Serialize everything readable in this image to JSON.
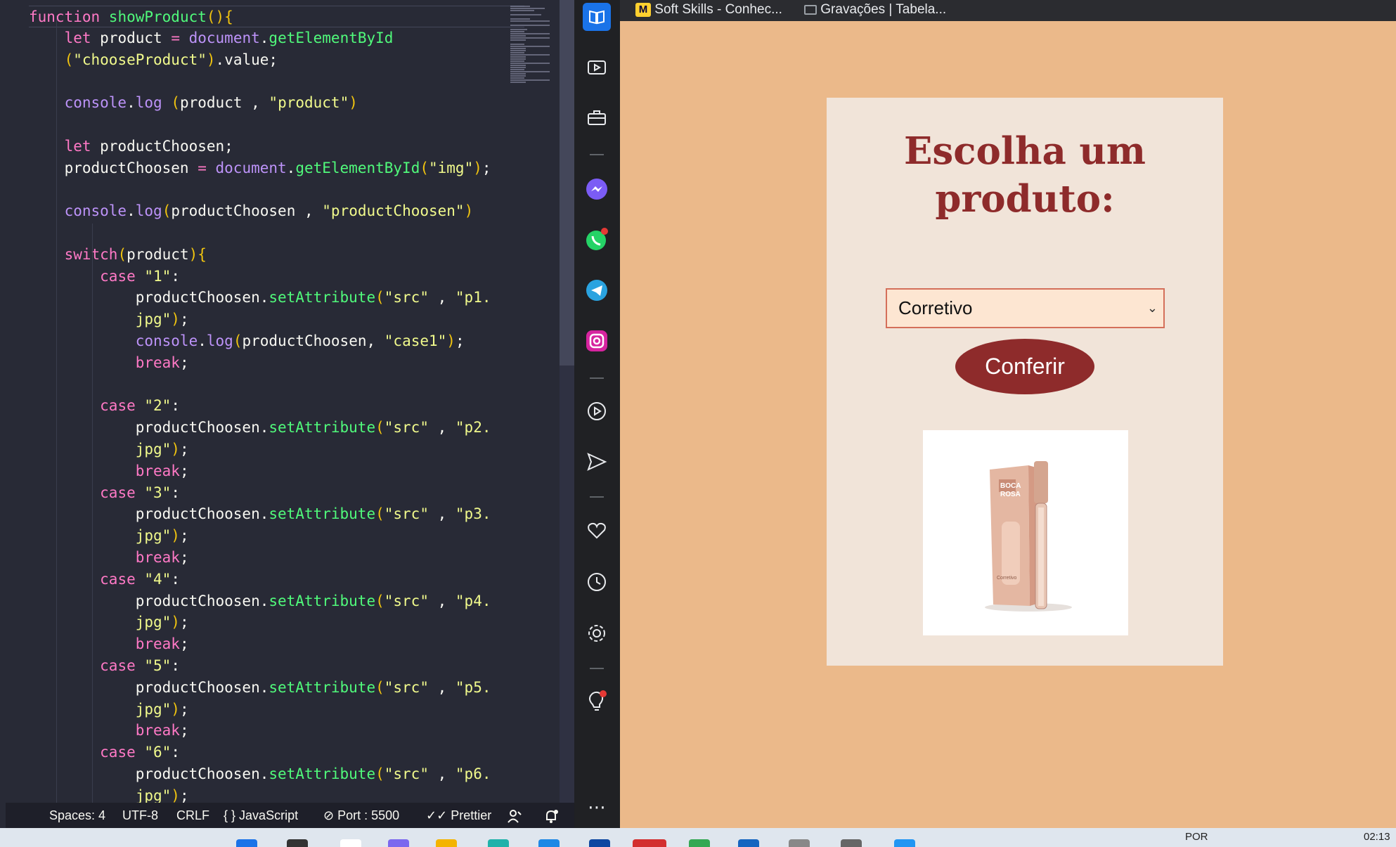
{
  "editor": {
    "lines": [
      [
        [
          "kw",
          "function "
        ],
        [
          "fname",
          "showProduct"
        ],
        [
          "br",
          "(){"
        ]
      ],
      [
        [
          "pr",
          "    "
        ],
        [
          "kw",
          "let "
        ],
        [
          "pr",
          "product "
        ],
        [
          "kw",
          "= "
        ],
        [
          "obj",
          "document"
        ],
        [
          "pr",
          "."
        ],
        [
          "fn",
          "getElementById"
        ]
      ],
      [
        [
          "pr",
          "    "
        ],
        [
          "br",
          "("
        ],
        [
          "str",
          "\"chooseProduct\""
        ],
        [
          "br",
          ")"
        ],
        [
          "pr",
          ".value;"
        ]
      ],
      [],
      [
        [
          "pr",
          "    "
        ],
        [
          "obj",
          "console"
        ],
        [
          "pr",
          "."
        ],
        [
          "obj",
          "log "
        ],
        [
          "br",
          "("
        ],
        [
          "pr",
          "product , "
        ],
        [
          "str",
          "\"product\""
        ],
        [
          "br",
          ")"
        ]
      ],
      [],
      [
        [
          "pr",
          "    "
        ],
        [
          "kw",
          "let "
        ],
        [
          "pr",
          "productChoosen;"
        ]
      ],
      [
        [
          "pr",
          "    productChoosen "
        ],
        [
          "kw",
          "= "
        ],
        [
          "obj",
          "document"
        ],
        [
          "pr",
          "."
        ],
        [
          "fn",
          "getElementById"
        ],
        [
          "br",
          "("
        ],
        [
          "str",
          "\"img\""
        ],
        [
          "br",
          ")"
        ],
        [
          "pr",
          ";"
        ]
      ],
      [],
      [
        [
          "pr",
          "    "
        ],
        [
          "obj",
          "console"
        ],
        [
          "pr",
          "."
        ],
        [
          "obj",
          "log"
        ],
        [
          "br",
          "("
        ],
        [
          "pr",
          "productChoosen , "
        ],
        [
          "str",
          "\"productChoosen\""
        ],
        [
          "br",
          ")"
        ]
      ],
      [],
      [
        [
          "pr",
          "    "
        ],
        [
          "kw",
          "switch"
        ],
        [
          "br",
          "("
        ],
        [
          "pr",
          "product"
        ],
        [
          "br",
          "){"
        ]
      ],
      [
        [
          "pr",
          "        "
        ],
        [
          "cs",
          "case "
        ],
        [
          "str",
          "\"1\""
        ],
        [
          "pr",
          ":"
        ]
      ],
      [
        [
          "pr",
          "            productChoosen."
        ],
        [
          "fn",
          "setAttribute"
        ],
        [
          "br",
          "("
        ],
        [
          "str",
          "\"src\""
        ],
        [
          "pr",
          " , "
        ],
        [
          "str",
          "\"p1."
        ]
      ],
      [
        [
          "pr",
          "            "
        ],
        [
          "str",
          "jpg\""
        ],
        [
          "br",
          ")"
        ],
        [
          "pr",
          ";"
        ]
      ],
      [
        [
          "pr",
          "            "
        ],
        [
          "obj",
          "console"
        ],
        [
          "pr",
          "."
        ],
        [
          "obj",
          "log"
        ],
        [
          "br",
          "("
        ],
        [
          "pr",
          "productChoosen, "
        ],
        [
          "str",
          "\"case1\""
        ],
        [
          "br",
          ")"
        ],
        [
          "pr",
          ";"
        ]
      ],
      [
        [
          "pr",
          "            "
        ],
        [
          "kw",
          "break"
        ],
        [
          "pr",
          ";"
        ]
      ],
      [],
      [
        [
          "pr",
          "        "
        ],
        [
          "cs",
          "case "
        ],
        [
          "str",
          "\"2\""
        ],
        [
          "pr",
          ":"
        ]
      ],
      [
        [
          "pr",
          "            productChoosen."
        ],
        [
          "fn",
          "setAttribute"
        ],
        [
          "br",
          "("
        ],
        [
          "str",
          "\"src\""
        ],
        [
          "pr",
          " , "
        ],
        [
          "str",
          "\"p2."
        ]
      ],
      [
        [
          "pr",
          "            "
        ],
        [
          "str",
          "jpg\""
        ],
        [
          "br",
          ")"
        ],
        [
          "pr",
          ";"
        ]
      ],
      [
        [
          "pr",
          "            "
        ],
        [
          "kw",
          "break"
        ],
        [
          "pr",
          ";"
        ]
      ],
      [
        [
          "pr",
          "        "
        ],
        [
          "cs",
          "case "
        ],
        [
          "str",
          "\"3\""
        ],
        [
          "pr",
          ":"
        ]
      ],
      [
        [
          "pr",
          "            productChoosen."
        ],
        [
          "fn",
          "setAttribute"
        ],
        [
          "br",
          "("
        ],
        [
          "str",
          "\"src\""
        ],
        [
          "pr",
          " , "
        ],
        [
          "str",
          "\"p3."
        ]
      ],
      [
        [
          "pr",
          "            "
        ],
        [
          "str",
          "jpg\""
        ],
        [
          "br",
          ")"
        ],
        [
          "pr",
          ";"
        ]
      ],
      [
        [
          "pr",
          "            "
        ],
        [
          "kw",
          "break"
        ],
        [
          "pr",
          ";"
        ]
      ],
      [
        [
          "pr",
          "        "
        ],
        [
          "cs",
          "case "
        ],
        [
          "str",
          "\"4\""
        ],
        [
          "pr",
          ":"
        ]
      ],
      [
        [
          "pr",
          "            productChoosen."
        ],
        [
          "fn",
          "setAttribute"
        ],
        [
          "br",
          "("
        ],
        [
          "str",
          "\"src\""
        ],
        [
          "pr",
          " , "
        ],
        [
          "str",
          "\"p4."
        ]
      ],
      [
        [
          "pr",
          "            "
        ],
        [
          "str",
          "jpg\""
        ],
        [
          "br",
          ")"
        ],
        [
          "pr",
          ";"
        ]
      ],
      [
        [
          "pr",
          "            "
        ],
        [
          "kw",
          "break"
        ],
        [
          "pr",
          ";"
        ]
      ],
      [
        [
          "pr",
          "        "
        ],
        [
          "cs",
          "case "
        ],
        [
          "str",
          "\"5\""
        ],
        [
          "pr",
          ":"
        ]
      ],
      [
        [
          "pr",
          "            productChoosen."
        ],
        [
          "fn",
          "setAttribute"
        ],
        [
          "br",
          "("
        ],
        [
          "str",
          "\"src\""
        ],
        [
          "pr",
          " , "
        ],
        [
          "str",
          "\"p5."
        ]
      ],
      [
        [
          "pr",
          "            "
        ],
        [
          "str",
          "jpg\""
        ],
        [
          "br",
          ")"
        ],
        [
          "pr",
          ";"
        ]
      ],
      [
        [
          "pr",
          "            "
        ],
        [
          "kw",
          "break"
        ],
        [
          "pr",
          ";"
        ]
      ],
      [
        [
          "pr",
          "        "
        ],
        [
          "cs",
          "case "
        ],
        [
          "str",
          "\"6\""
        ],
        [
          "pr",
          ":"
        ]
      ],
      [
        [
          "pr",
          "            productChoosen."
        ],
        [
          "fn",
          "setAttribute"
        ],
        [
          "br",
          "("
        ],
        [
          "str",
          "\"src\""
        ],
        [
          "pr",
          " , "
        ],
        [
          "str",
          "\"p6."
        ]
      ],
      [
        [
          "pr",
          "            "
        ],
        [
          "str",
          "jpg\""
        ],
        [
          "br",
          ")"
        ],
        [
          "pr",
          ";"
        ]
      ]
    ],
    "colors": {
      "background": "#282a36",
      "keyword": "#ff79c6",
      "function": "#50fa7b",
      "string": "#f1fa8c",
      "object": "#bd93f9"
    }
  },
  "statusbar": {
    "spaces": "Spaces: 4",
    "encoding": "UTF-8",
    "eol": "CRLF",
    "language": "JavaScript",
    "port": "Port : 5500",
    "prettier": "Prettier",
    "icons": [
      "braces-icon",
      "no-entry-icon",
      "double-check-icon",
      "account-icon",
      "bell-icon"
    ]
  },
  "sidebar": {
    "icons": [
      "reader-icon",
      "video-icon",
      "briefcase-icon",
      "messenger-icon",
      "whatsapp-icon",
      "telegram-icon",
      "instagram-icon",
      "play-icon",
      "send-icon",
      "heart-icon",
      "clock-icon",
      "gear-icon",
      "lightbulb-icon",
      "more-icon"
    ]
  },
  "bookmarks": {
    "items": [
      {
        "label": "Soft Skills - Conhec...",
        "icon": "miro-icon"
      },
      {
        "label": "Gravações | Tabela...",
        "icon": "folder-icon"
      }
    ]
  },
  "page": {
    "title": "Escolha um produto:",
    "select": {
      "selected": "Corretivo"
    },
    "button_label": "Conferir",
    "image_alt": "produto",
    "image_text": {
      "brand_line1": "BOCA",
      "brand_line2": "ROSA",
      "product": "Corretivo"
    },
    "colors": {
      "background": "#ebb98a",
      "card": "#f1e4d9",
      "accent": "#8e2b2b",
      "select_bg": "#fde6d2"
    }
  },
  "taskbar": {
    "language": "POR",
    "clock": "02:13"
  }
}
